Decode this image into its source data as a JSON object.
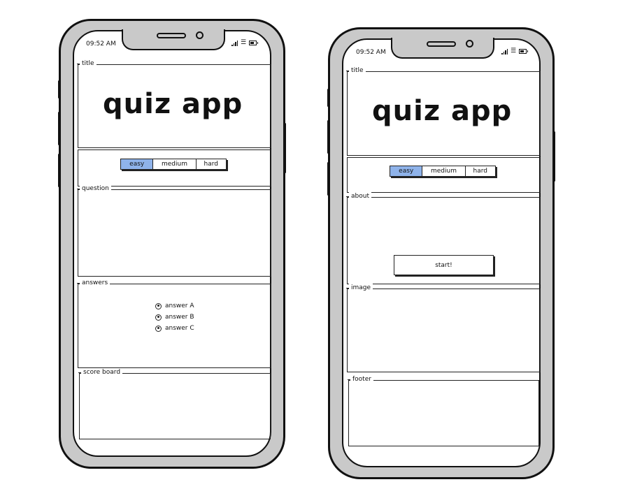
{
  "phone_left": {
    "status_bar": {
      "time": "09:52 AM",
      "icons": [
        "signal-icon",
        "wifi-icon",
        "battery-icon"
      ]
    },
    "title_panel": {
      "legend": "title",
      "heading": "quiz app"
    },
    "difficulty": {
      "options": [
        "easy",
        "medium",
        "hard"
      ],
      "selected": "easy"
    },
    "question_panel": {
      "legend": "question"
    },
    "answers_panel": {
      "legend": "answers",
      "options": [
        "answer A",
        "answer B",
        "answer C"
      ]
    },
    "scoreboard_panel": {
      "legend": "score board"
    }
  },
  "phone_right": {
    "status_bar": {
      "time": "09:52 AM",
      "icons": [
        "signal-icon",
        "wifi-icon",
        "battery-icon"
      ]
    },
    "title_panel": {
      "legend": "title",
      "heading": "quiz app"
    },
    "difficulty": {
      "options": [
        "easy",
        "medium",
        "hard"
      ],
      "selected": "easy"
    },
    "about_panel": {
      "legend": "about",
      "button_label": "start!"
    },
    "image_panel": {
      "legend": "image"
    },
    "footer_panel": {
      "legend": "footer"
    }
  },
  "colors": {
    "selected_segment": "#8fb3ea",
    "phone_frame": "#c9c9c9",
    "outline": "#111111"
  }
}
